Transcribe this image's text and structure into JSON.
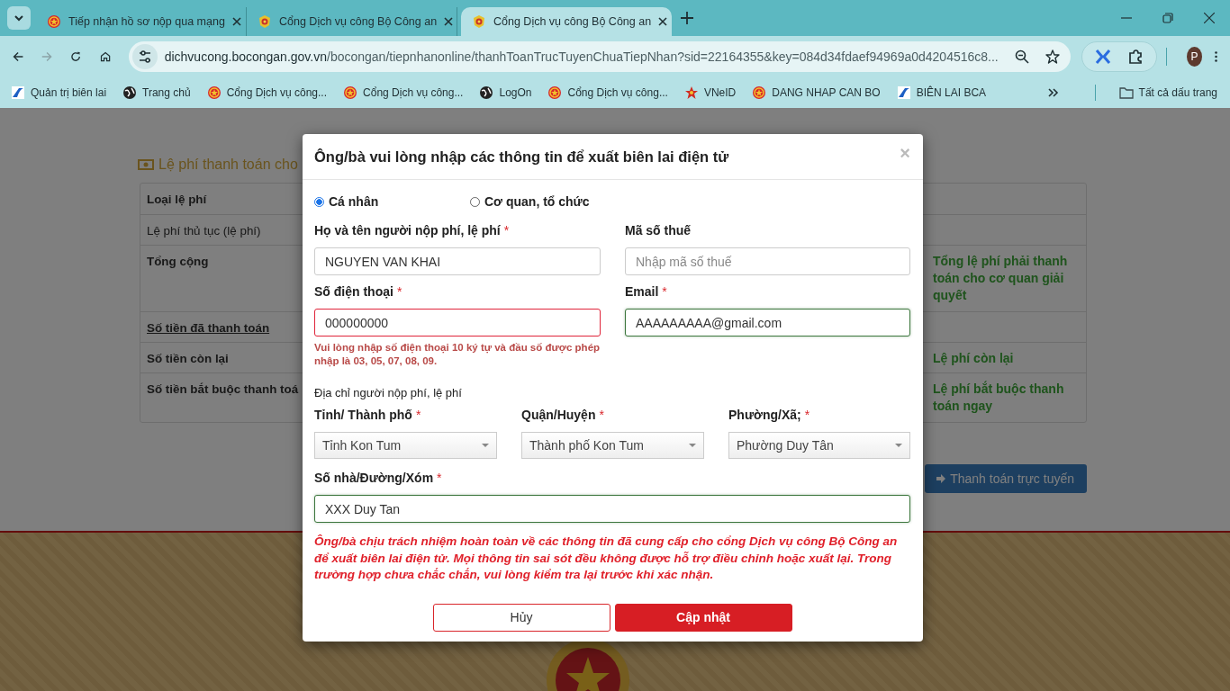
{
  "browser": {
    "tabs": [
      {
        "title": "Tiếp nhận hồ sơ nộp qua mạng",
        "kind": "emblem",
        "selected": false
      },
      {
        "title": "Cổng Dịch vụ công Bộ Công an",
        "kind": "badge",
        "selected": false
      },
      {
        "title": "Cổng Dịch vụ công Bộ Công an",
        "kind": "badge",
        "selected": true
      }
    ],
    "url": {
      "host": "dichvucong.bocongan.gov.vn",
      "path": "/bocongan/tiepnhanonline/thanhToanTrucTuyenChuaTiepNhan?sid=22164355&key=084d34fdaef94969a0d4204516c8..."
    },
    "profile": "P",
    "bookmarks": [
      {
        "label": "Quản trị biên lai",
        "kind": "logo"
      },
      {
        "label": "Trang chủ",
        "kind": "globe"
      },
      {
        "label": "Cổng Dịch vụ công...",
        "kind": "emblem"
      },
      {
        "label": "Cổng Dịch vụ công...",
        "kind": "emblem"
      },
      {
        "label": "LogOn",
        "kind": "globe"
      },
      {
        "label": "Cổng Dịch vụ công...",
        "kind": "emblem"
      },
      {
        "label": "VNeID",
        "kind": "star"
      },
      {
        "label": "DANG NHAP CAN BO",
        "kind": "emblem"
      },
      {
        "label": "BIÊN LAI BCA",
        "kind": "logo"
      }
    ],
    "all_bookmarks": "Tất cả dấu trang"
  },
  "page": {
    "fee_title": "Lệ phí thanh toán cho",
    "rows": [
      {
        "label": "Loại lệ phí",
        "kind": "header"
      },
      {
        "label": "Lệ phí thủ tục (lệ phí)",
        "kind": "plain"
      },
      {
        "label": "Tổng cộng",
        "kind": "bold",
        "note": "Tổng lệ phí phải thanh toán cho cơ quan giải quyết"
      },
      {
        "label": "Số tiền đã thanh toán",
        "kind": "link"
      },
      {
        "label": "Số tiền còn lại",
        "kind": "bold",
        "note": "Lệ phí còn lại"
      },
      {
        "label": "Số tiền bắt buộc thanh toá",
        "kind": "bold",
        "note": "Lệ phí bắt buộc thanh toán ngay"
      }
    ],
    "pay_button": "Thanh toán trực tuyến"
  },
  "modal": {
    "title": "Ông/bà vui lòng nhập các thông tin để xuất biên lai điện tử",
    "close": "×",
    "customer_types": [
      {
        "label": "Cá nhân",
        "selected": true
      },
      {
        "label": "Cơ quan, tổ chức",
        "selected": false
      }
    ],
    "fields": [
      {
        "label": "Họ và tên người nộp phí, lệ phí",
        "mark": "*",
        "value": "NGUYEN VAN KHAI",
        "invalid": false,
        "valid": false
      },
      {
        "label": "Mã số thuế",
        "placeholder": "Nhập mã số thuế",
        "invalid": false,
        "valid": false
      },
      {
        "label": "Số điện thoại",
        "mark": "*",
        "value": "000000000",
        "invalid": true,
        "valid": false,
        "error": "Vui lòng nhập số điện thoại 10 ký tự và đầu số được phép nhập là 03, 05, 07, 08, 09."
      },
      {
        "label": "Email",
        "mark": "*",
        "value": "AAAAAAAAA@gmail.com",
        "invalid": false,
        "valid": true
      }
    ],
    "address_heading": "Địa chỉ người nộp phí, lệ phí",
    "selects": [
      {
        "label": "Tỉnh/ Thành phố",
        "mark": "*",
        "value": "Tỉnh Kon Tum"
      },
      {
        "label": "Quận/Huyện",
        "mark": "*",
        "value": "Thành phố Kon Tum"
      },
      {
        "label": "Phường/Xã;",
        "mark": "*",
        "value": "Phường Duy Tân"
      }
    ],
    "street": {
      "label": "Số nhà/Đường/Xóm",
      "mark": "*",
      "value": "XXX Duy Tan",
      "invalid": false,
      "valid": true
    },
    "warning": "Ông/bà chịu trách nhiệm hoàn toàn về các thông tin đã cung cấp cho cổng Dịch vụ công Bộ Công an để xuất biên lai điện tử. Mọi thông tin sai sót đều không được hỗ trợ điều chỉnh hoặc xuất lại. Trong trường hợp chưa chắc chắn, vui lòng kiểm tra lại trước khi xác nhận.",
    "cancel": "Hủy",
    "submit": "Cập nhật"
  }
}
